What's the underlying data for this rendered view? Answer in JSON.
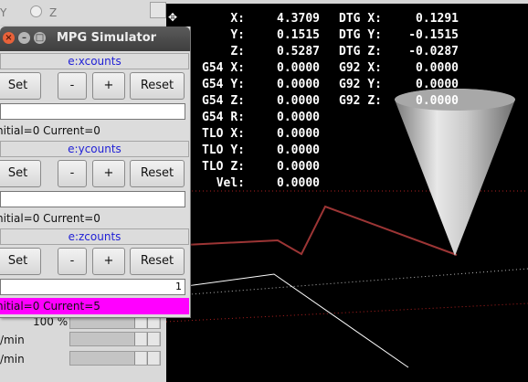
{
  "background_window": {
    "top_radio_left": "Y",
    "top_radio_right": "Z",
    "override_value": "100 %",
    "rate1_label": "/min",
    "rate2_label": "/min"
  },
  "dro": {
    "rows": [
      {
        "l1": "X:",
        "v1": "4.3709",
        "l2": "DTG X:",
        "v2": "0.1291"
      },
      {
        "l1": "Y:",
        "v1": "0.1515",
        "l2": "DTG Y:",
        "v2": "-0.1515"
      },
      {
        "l1": "Z:",
        "v1": "0.5287",
        "l2": "DTG Z:",
        "v2": "-0.0287"
      },
      {
        "l1": "G54 X:",
        "v1": "0.0000",
        "l2": "G92 X:",
        "v2": "0.0000"
      },
      {
        "l1": "G54 Y:",
        "v1": "0.0000",
        "l2": "G92 Y:",
        "v2": "0.0000"
      },
      {
        "l1": "G54 Z:",
        "v1": "0.0000",
        "l2": "G92 Z:",
        "v2": "0.0000"
      },
      {
        "l1": "G54 R:",
        "v1": "0.0000",
        "l2": "",
        "v2": ""
      },
      {
        "l1": "TLO X:",
        "v1": "0.0000",
        "l2": "",
        "v2": ""
      },
      {
        "l1": "TLO Y:",
        "v1": "0.0000",
        "l2": "",
        "v2": ""
      },
      {
        "l1": "TLO Z:",
        "v1": "0.0000",
        "l2": "",
        "v2": ""
      },
      {
        "l1": "Vel:",
        "v1": "0.0000",
        "l2": "",
        "v2": ""
      }
    ]
  },
  "mpg": {
    "title": "MPG Simulator",
    "axes": [
      {
        "name": "e:xcounts",
        "set": "Set",
        "minus": "-",
        "plus": "+",
        "reset": "Reset",
        "field": "",
        "status": "nitial=0 Current=0",
        "highlight": false
      },
      {
        "name": "e:ycounts",
        "set": "Set",
        "minus": "-",
        "plus": "+",
        "reset": "Reset",
        "field": "",
        "status": "nitial=0 Current=0",
        "highlight": false
      },
      {
        "name": "e:zcounts",
        "set": "Set",
        "minus": "-",
        "plus": "+",
        "reset": "Reset",
        "field": "1",
        "status": "nitial=0 Current=5",
        "highlight": true
      }
    ]
  },
  "colors": {
    "toolpath": "#9c3535",
    "limit_dotted": "#b02020",
    "feed_line": "#ffffff",
    "status_highlight": "#ff00ff",
    "axis_title": "#1f1fd6"
  }
}
